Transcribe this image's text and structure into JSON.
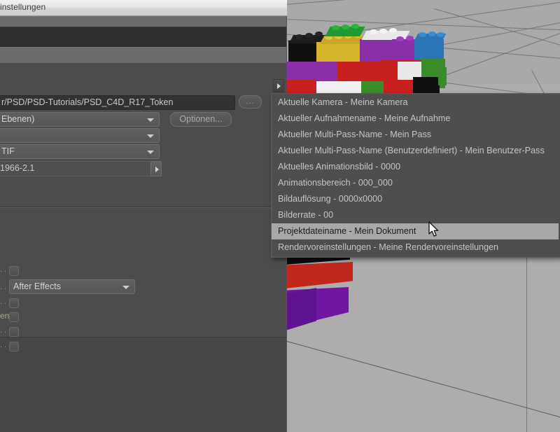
{
  "window": {
    "title": "instellungen",
    "path_field": {
      "value": "r/PSD/PSD-Tutorials/PSD_C4D_R17_Token",
      "browse_label": "..."
    },
    "format_combo": {
      "value": "Ebenen)"
    },
    "empty_combo": {
      "value": ""
    },
    "filetype_combo": {
      "value": "TIF"
    },
    "profile_field": {
      "value": "1966-2.1"
    },
    "options_button": {
      "label": "Optionen..."
    },
    "composite_combo": {
      "value": "After Effects"
    },
    "cut_labels": {
      "left_fragment": "en"
    }
  },
  "token_menu": {
    "items": [
      {
        "label": "Aktuelle Kamera - Meine Kamera",
        "selected": false
      },
      {
        "label": "Aktueller Aufnahmename - Meine Aufnahme",
        "selected": false
      },
      {
        "label": "Aktueller Multi-Pass-Name - Mein Pass",
        "selected": false
      },
      {
        "label": "Aktueller Multi-Pass-Name (Benutzerdefiniert) - Mein Benutzer-Pass",
        "selected": false
      },
      {
        "label": "Aktuelles Animationsbild - 0000",
        "selected": false
      },
      {
        "label": "Animationsbereich - 000_000",
        "selected": false
      },
      {
        "label": "Bildauflösung - 0000x0000",
        "selected": false
      },
      {
        "label": "Bilderrate - 00",
        "selected": false
      },
      {
        "label": "Projektdateiname - Mein Dokument",
        "selected": true
      },
      {
        "label": "Rendervoreinstellungen - Meine Rendervoreinstellungen",
        "selected": false
      }
    ]
  },
  "viewport": {
    "description": "3D perspective viewport with grid floor and colored LEGO brick assembly",
    "background_color": "#a9a9a9",
    "grid_color": "#6f6f6f",
    "lego_colors": [
      "#111111",
      "#d6b42c",
      "#ffffff",
      "#2b74b8",
      "#1f9a2e",
      "#8b2fa8",
      "#c81f1f",
      "#e8e8e8",
      "#3a8c2a"
    ]
  },
  "colors": {
    "panel": "#4c4c4c",
    "menu_bg": "#4e4e4e",
    "menu_text": "#c5c5c5",
    "menu_selected_bg": "#a8a8a8",
    "menu_selected_text": "#1b1b1b",
    "titlebar_text": "#3a3a3a"
  }
}
